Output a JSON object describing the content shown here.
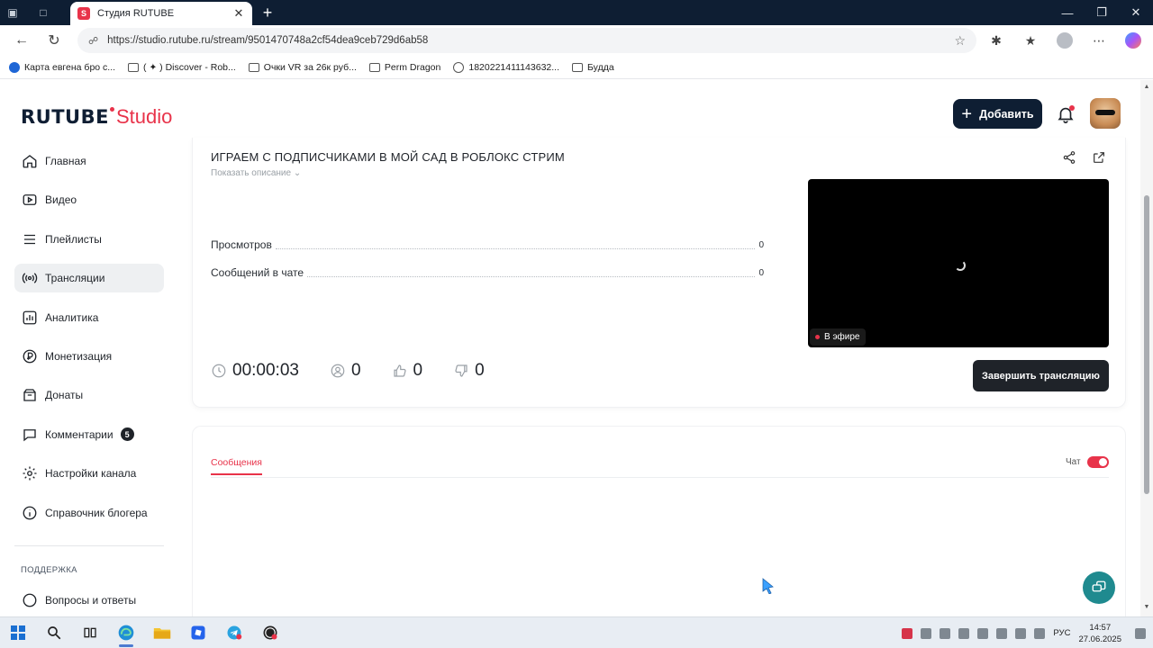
{
  "browser": {
    "tab_title": "Студия RUTUBE",
    "tab_favicon": "S",
    "url": "https://studio.rutube.ru/stream/9501470748a2cf54dea9ceb729d6ab58",
    "bookmarks": [
      {
        "label": "Карта евгена бро с...",
        "icon": "map-icon"
      },
      {
        "label": "( ✦ ) Discover - Rob...",
        "icon": "page-icon"
      },
      {
        "label": "Очки VR за 26к руб...",
        "icon": "folder-icon"
      },
      {
        "label": "Perm Dragon",
        "icon": "folder-icon"
      },
      {
        "label": "1820221411143632...",
        "icon": "globe-icon"
      },
      {
        "label": "Будда",
        "icon": "folder-icon"
      }
    ]
  },
  "header": {
    "logo_text": "RUTUBE",
    "logo_suffix": "Studio",
    "add_button_label": "Добавить"
  },
  "sidebar": {
    "items": [
      {
        "label": "Главная",
        "icon": "home-icon"
      },
      {
        "label": "Видео",
        "icon": "video-icon"
      },
      {
        "label": "Плейлисты",
        "icon": "playlist-icon"
      },
      {
        "label": "Трансляции",
        "icon": "broadcast-icon",
        "active": true
      },
      {
        "label": "Аналитика",
        "icon": "analytics-icon"
      },
      {
        "label": "Монетизация",
        "icon": "money-icon"
      },
      {
        "label": "Донаты",
        "icon": "donate-icon"
      },
      {
        "label": "Комментарии",
        "icon": "comments-icon",
        "badge": "5"
      },
      {
        "label": "Настройки канала",
        "icon": "settings-icon"
      },
      {
        "label": "Справочник блогера",
        "icon": "info-icon"
      }
    ],
    "support_title": "ПОДДЕРЖКА",
    "faq_label": "Вопросы и ответы"
  },
  "stream": {
    "title": "ИГРАЕМ С ПОДПИСЧИКАМИ В МОЙ САД В РОБЛОКС СТРИМ",
    "show_description": "Показать описание",
    "stats": [
      {
        "label": "Просмотров",
        "value": "0"
      },
      {
        "label": "Сообщений в чате",
        "value": "0"
      }
    ],
    "metrics": {
      "duration": "00:00:03",
      "viewers": "0",
      "likes": "0",
      "dislikes": "0"
    },
    "live_badge": "В эфире",
    "end_button_label": "Завершить трансляцию"
  },
  "chat": {
    "tab_label": "Сообщения",
    "toggle_label": "Чат",
    "toggle_on": true
  },
  "taskbar": {
    "time": "14:57",
    "date": "27.06.2025",
    "language": "РУС"
  },
  "colors": {
    "accent": "#e8334a",
    "dark": "#0e1e33",
    "help_button": "#1f8a8f"
  }
}
